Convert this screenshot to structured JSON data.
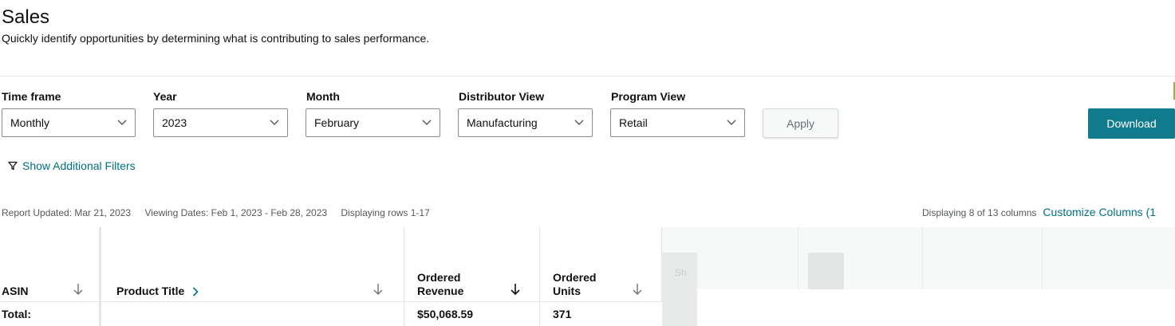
{
  "header": {
    "title": "Sales",
    "subtitle": "Quickly identify opportunities by determining what is contributing to sales performance."
  },
  "filters": [
    {
      "label": "Time frame",
      "value": "Monthly"
    },
    {
      "label": "Year",
      "value": "2023"
    },
    {
      "label": "Month",
      "value": "February"
    },
    {
      "label": "Distributor View",
      "value": "Manufacturing"
    },
    {
      "label": "Program View",
      "value": "Retail"
    }
  ],
  "actions": {
    "apply_label": "Apply",
    "download_label": "Download",
    "show_filters_label": "Show Additional Filters"
  },
  "report_meta": {
    "updated": "Report Updated: Mar 21, 2023",
    "viewing_dates": "Viewing Dates: Feb 1, 2023 - Feb 28, 2023",
    "rows": "Displaying rows 1-17",
    "columns_info": "Displaying 8 of 13 columns",
    "customize_label": "Customize Columns (1"
  },
  "table": {
    "columns": [
      {
        "line1": "",
        "line2": "ASIN"
      },
      {
        "line1": "",
        "line2": "Product Title"
      },
      {
        "line1": "Ordered",
        "line2": "Revenue"
      },
      {
        "line1": "Ordered",
        "line2": "Units"
      }
    ],
    "total_row": {
      "label": "Total:",
      "product_title": "",
      "ordered_revenue": "$50,068.59",
      "ordered_units": "371"
    },
    "faded_header": "Sh"
  },
  "colors": {
    "accent": "#107b8c",
    "link": "#007185",
    "green_marker": "#7fc13a"
  }
}
